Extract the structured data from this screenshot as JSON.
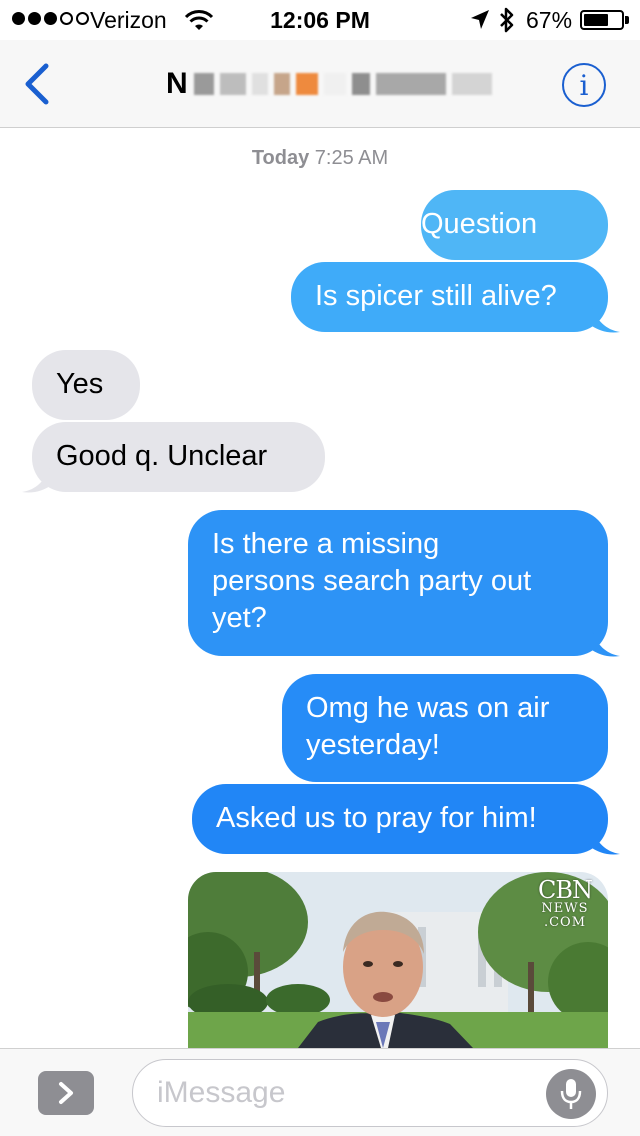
{
  "status_bar": {
    "signal_bars_filled": 3,
    "signal_bars_total": 5,
    "carrier": "Verizon",
    "time": "12:06 PM",
    "battery_percent": "67%",
    "battery_level": 0.67
  },
  "nav": {
    "contact_initial": "N",
    "contact_name_redacted": true,
    "info_glyph": "i"
  },
  "conversation": {
    "date_label": "Today",
    "time_label": "7:25 AM",
    "messages": [
      {
        "direction": "outgoing",
        "text": "Question"
      },
      {
        "direction": "outgoing",
        "text": "Is spicer still alive?"
      },
      {
        "direction": "incoming",
        "text": "Yes"
      },
      {
        "direction": "incoming",
        "text": "Good q. Unclear"
      },
      {
        "direction": "outgoing",
        "text": "Is there a missing\npersons search party out\nyet?"
      },
      {
        "direction": "outgoing",
        "text": "Omg he was on air\nyesterday!"
      },
      {
        "direction": "outgoing",
        "text": "Asked us to pray for him!"
      }
    ],
    "media": {
      "logo_main": "CBN",
      "logo_sub": "NEWS",
      "logo_domain": ".COM"
    }
  },
  "input_bar": {
    "placeholder": "iMessage",
    "value": ""
  },
  "colors": {
    "ios_blue": "#1a5fd0",
    "bubble_gray": "#e5e5ea",
    "outgoing_gradient_top": "#4fb6f6",
    "outgoing_gradient_bottom": "#2186f6"
  },
  "icons": [
    "back-chevron-icon",
    "info-icon",
    "wifi-icon",
    "location-arrow-icon",
    "bluetooth-icon",
    "battery-icon",
    "apps-chevron-icon",
    "microphone-icon"
  ]
}
